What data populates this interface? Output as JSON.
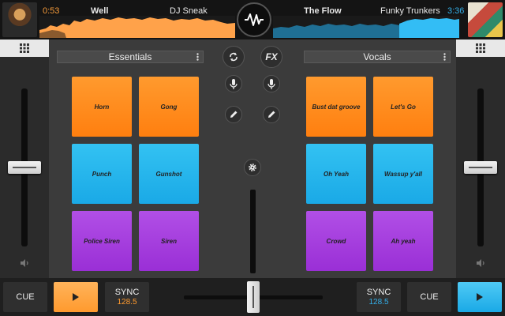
{
  "deck_left": {
    "time": "0:53",
    "title": "Well",
    "artist": "DJ Sneak",
    "header": "Essentials",
    "pads": [
      "Horn",
      "Gong",
      "Punch",
      "Gunshot",
      "Police Siren",
      "Siren"
    ],
    "sync_label": "SYNC",
    "bpm": "128.5",
    "cue_label": "CUE",
    "accent": "#ff9a2e"
  },
  "deck_right": {
    "time": "3:36",
    "title": "The Flow",
    "artist": "Funky Trunkers",
    "header": "Vocals",
    "pads": [
      "Bust dat groove",
      "Let's Go",
      "Oh Yeah",
      "Wassup y'all",
      "Crowd",
      "Ah yeah"
    ],
    "sync_label": "SYNC",
    "bpm": "128.5",
    "cue_label": "CUE",
    "accent": "#1aa9e6"
  },
  "center": {
    "fx_label": "FX"
  },
  "icons": {
    "grid": "grid-icon",
    "speaker": "speaker-icon",
    "loop": "loop-icon",
    "mic": "mic-icon",
    "pencil": "pencil-icon",
    "settings": "gear-icon",
    "play": "play-icon",
    "logo": "waveform-logo-icon"
  }
}
